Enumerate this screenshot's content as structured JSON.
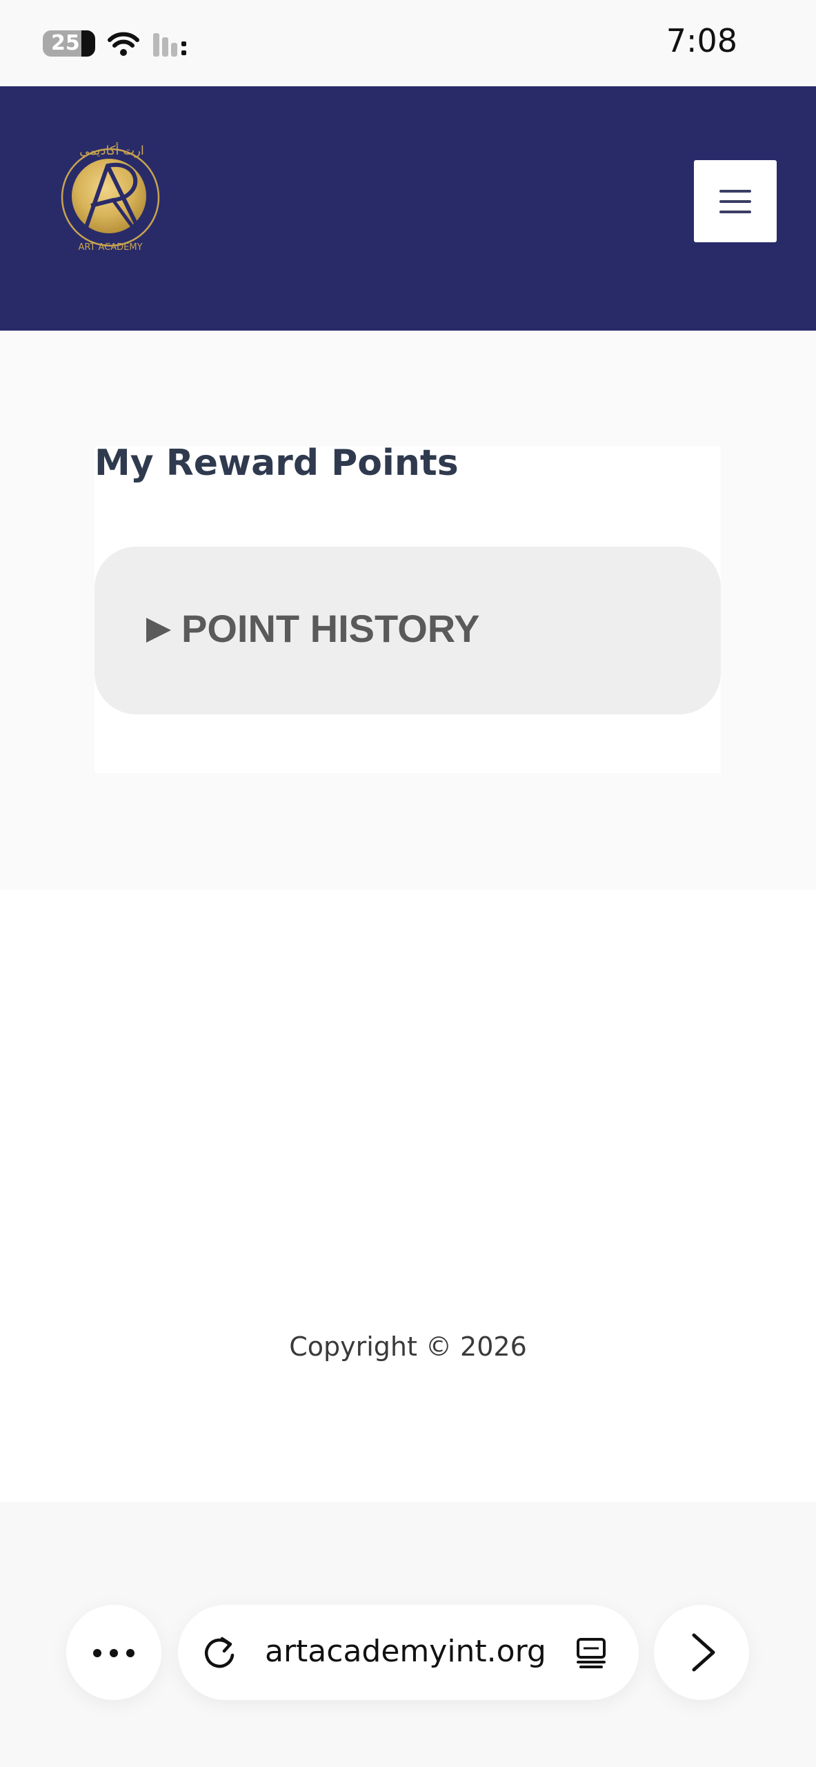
{
  "status_bar": {
    "battery_level": "25",
    "time": "7:08"
  },
  "header": {
    "logo": {
      "arabic_text": "ارت أكاديمي",
      "english_text": "ART ACADEMY",
      "gold_color": "#d8b45a"
    },
    "menu_icon": "hamburger-menu-icon",
    "background_color": "#292b69"
  },
  "main": {
    "title": "My Reward Points",
    "point_history": {
      "arrow_icon": "play-triangle-icon",
      "label": "POINT HISTORY"
    }
  },
  "footer": {
    "copyright": "Copyright © 2026"
  },
  "browser": {
    "more_icon": "ellipsis-icon",
    "reload_icon": "reload-icon",
    "url": "artacademyint.org",
    "tabs_icon": "tabs-icon",
    "forward_icon": "chevron-right-icon"
  }
}
